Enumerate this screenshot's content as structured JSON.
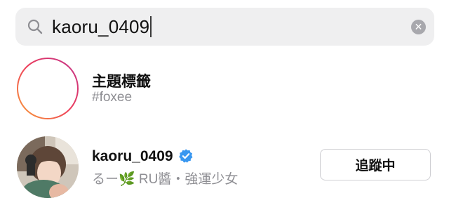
{
  "search": {
    "query": "kaoru_0409"
  },
  "results": [
    {
      "type": "hashtag",
      "title": "主題標籤",
      "subtitle": "#foxee"
    },
    {
      "type": "user",
      "username": "kaoru_0409",
      "verified": true,
      "subtitle": "るー🌿 RU醬・強運少女",
      "follow_label": "追蹤中"
    }
  ],
  "colors": {
    "verified": "#3897f0",
    "subtitle": "#8e8e93",
    "search_bg": "#efeff0"
  },
  "icons": {
    "search": "search-icon",
    "clear": "clear-icon",
    "hashtag": "hashtag-icon",
    "verified": "verified-badge-icon"
  }
}
